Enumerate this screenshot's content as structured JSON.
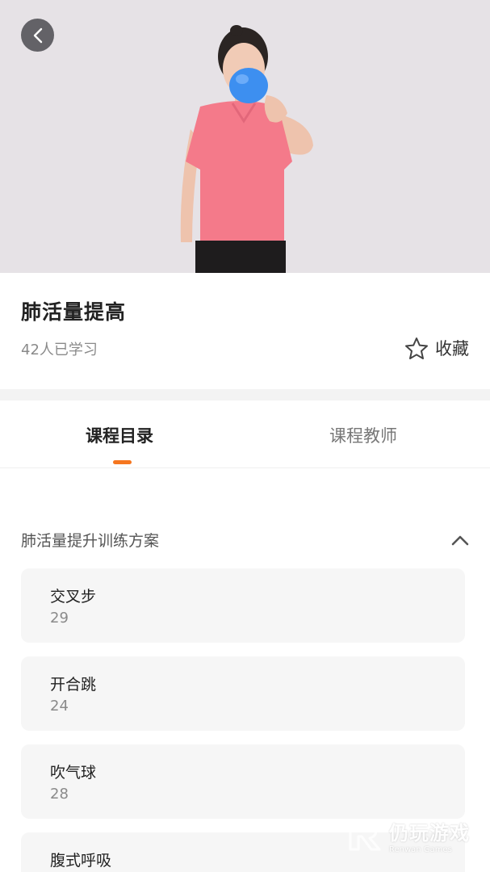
{
  "course": {
    "title": "肺活量提高",
    "learners": "42人已学习",
    "favorite_label": "收藏"
  },
  "tabs": [
    {
      "label": "课程目录",
      "active": true
    },
    {
      "label": "课程教师",
      "active": false
    }
  ],
  "catalog": {
    "section_title": "肺活量提升训练方案",
    "lessons": [
      {
        "name": "交叉步",
        "count": "29"
      },
      {
        "name": "开合跳",
        "count": "24"
      },
      {
        "name": "吹气球",
        "count": "28"
      },
      {
        "name": "腹式呼吸",
        "count": ""
      }
    ]
  },
  "watermark": {
    "cn": "仍玩游戏",
    "en": "Renwan Games"
  },
  "colors": {
    "accent": "#f5761f",
    "shirt": "#f47a8a",
    "balloon": "#3d8ff0"
  },
  "icons": [
    "back-arrow-icon",
    "star-outline-icon",
    "chevron-up-icon"
  ]
}
